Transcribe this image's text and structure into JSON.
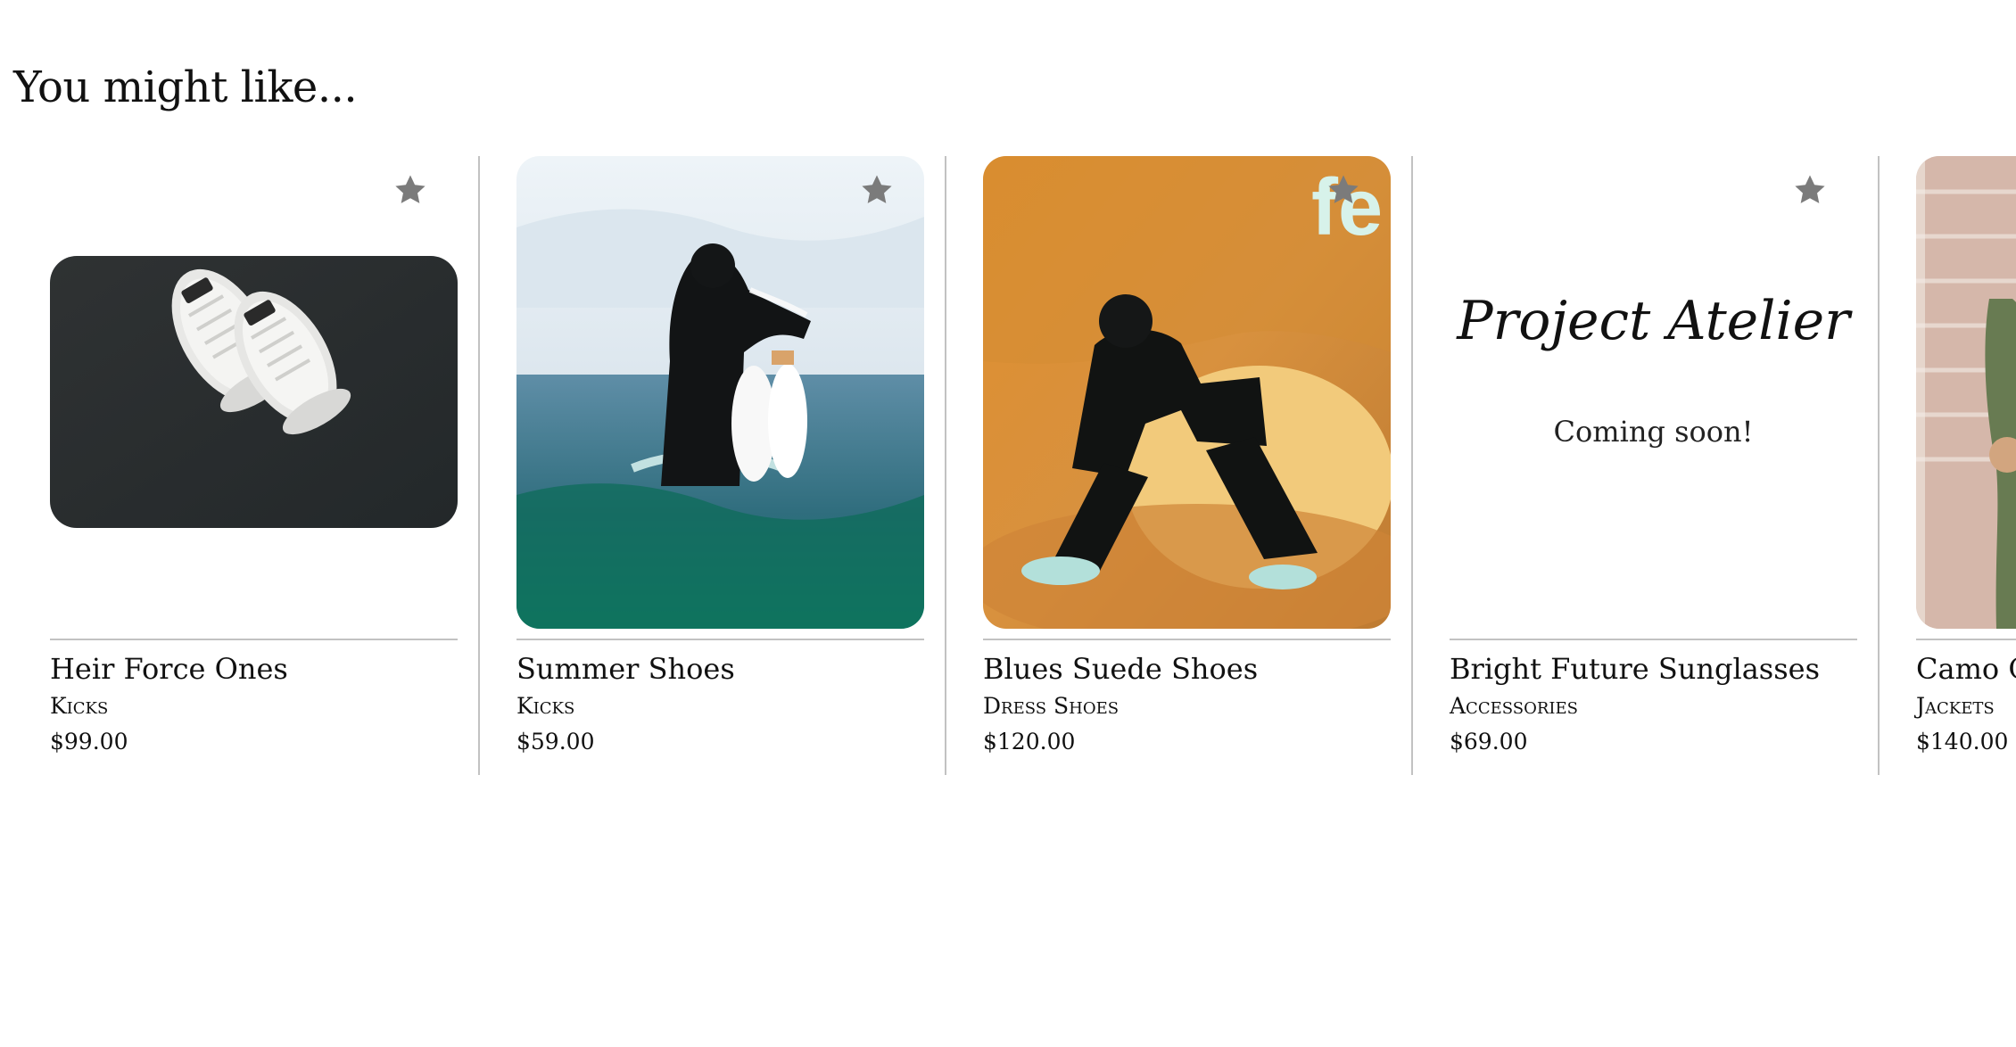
{
  "section": {
    "title": "You might like..."
  },
  "products": [
    {
      "name": "Heir Force Ones",
      "category": "Kicks",
      "price": "$99.00",
      "image": "white-sneakers-photo",
      "favorite_icon": "star-icon"
    },
    {
      "name": "Summer Shoes",
      "category": "Kicks",
      "price": "$59.00",
      "image": "person-in-water-holding-shoes-photo",
      "favorite_icon": "star-icon"
    },
    {
      "name": "Blues Suede Shoes",
      "category": "Dress Shoes",
      "price": "$120.00",
      "image": "person-sitting-on-fur-chair-photo",
      "favorite_icon": "star-icon"
    },
    {
      "name": "Bright Future Sunglasses",
      "category": "Accessories",
      "price": "$69.00",
      "placeholder_brand": "Project Atelier",
      "placeholder_note": "Coming soon!",
      "favorite_icon": "star-icon"
    },
    {
      "name": "Camo O",
      "category": "Jackets",
      "price": "$140.00",
      "image": "camo-jacket-photo"
    }
  ],
  "colors": {
    "star": "#7b7b7b",
    "divider": "#c2c2c2",
    "text": "#111111"
  }
}
